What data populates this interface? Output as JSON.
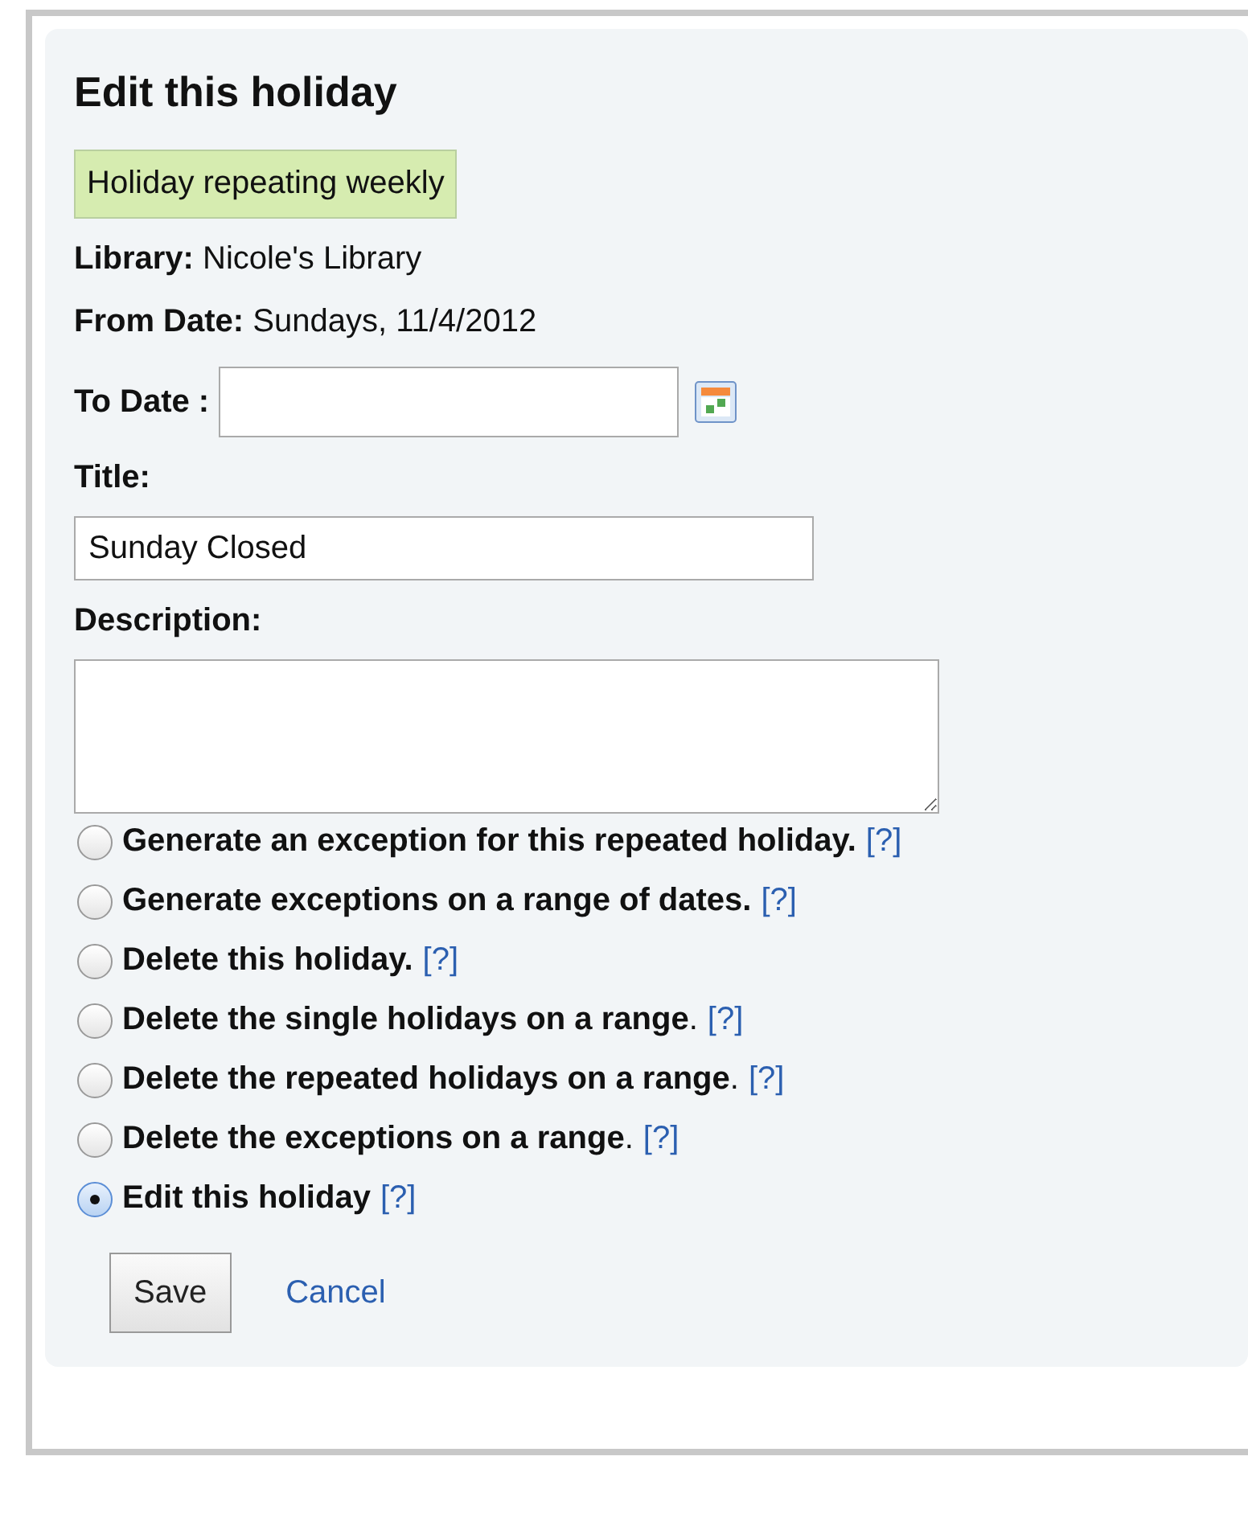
{
  "heading": "Edit this holiday",
  "notice": "Holiday repeating weekly",
  "info": [
    {
      "label": "Library:",
      "value": "Nicole's Library"
    },
    {
      "label": "From Date:",
      "value": "Sundays, 11/4/2012"
    }
  ],
  "to_date": {
    "label": "To Date :"
  },
  "title_field": {
    "label": "Title:",
    "value": "Sunday Closed"
  },
  "description_field": {
    "label": "Description:"
  },
  "options": [
    {
      "label": "**Generate an exception for this repeated holiday.**",
      "help": "[?]",
      "selected": false
    },
    {
      "label": "**Generate exceptions on a range of dates.**",
      "help": "[?]",
      "selected": false
    },
    {
      "label": "**Delete this holiday.**",
      "help": "[?]",
      "selected": false
    },
    {
      "label": "**Delete the single holidays on a range**.",
      "help": "[?]",
      "selected": false
    },
    {
      "label": "**Delete the repeated holidays on a range**.",
      "help": "[?]",
      "selected": false
    },
    {
      "label": "**Delete the exceptions on a range**.",
      "help": "[?]",
      "selected": false
    },
    {
      "label": "**Edit this holiday**",
      "help": "[?]",
      "selected": true
    }
  ],
  "buttons": {
    "save": "Save",
    "cancel": "Cancel"
  }
}
